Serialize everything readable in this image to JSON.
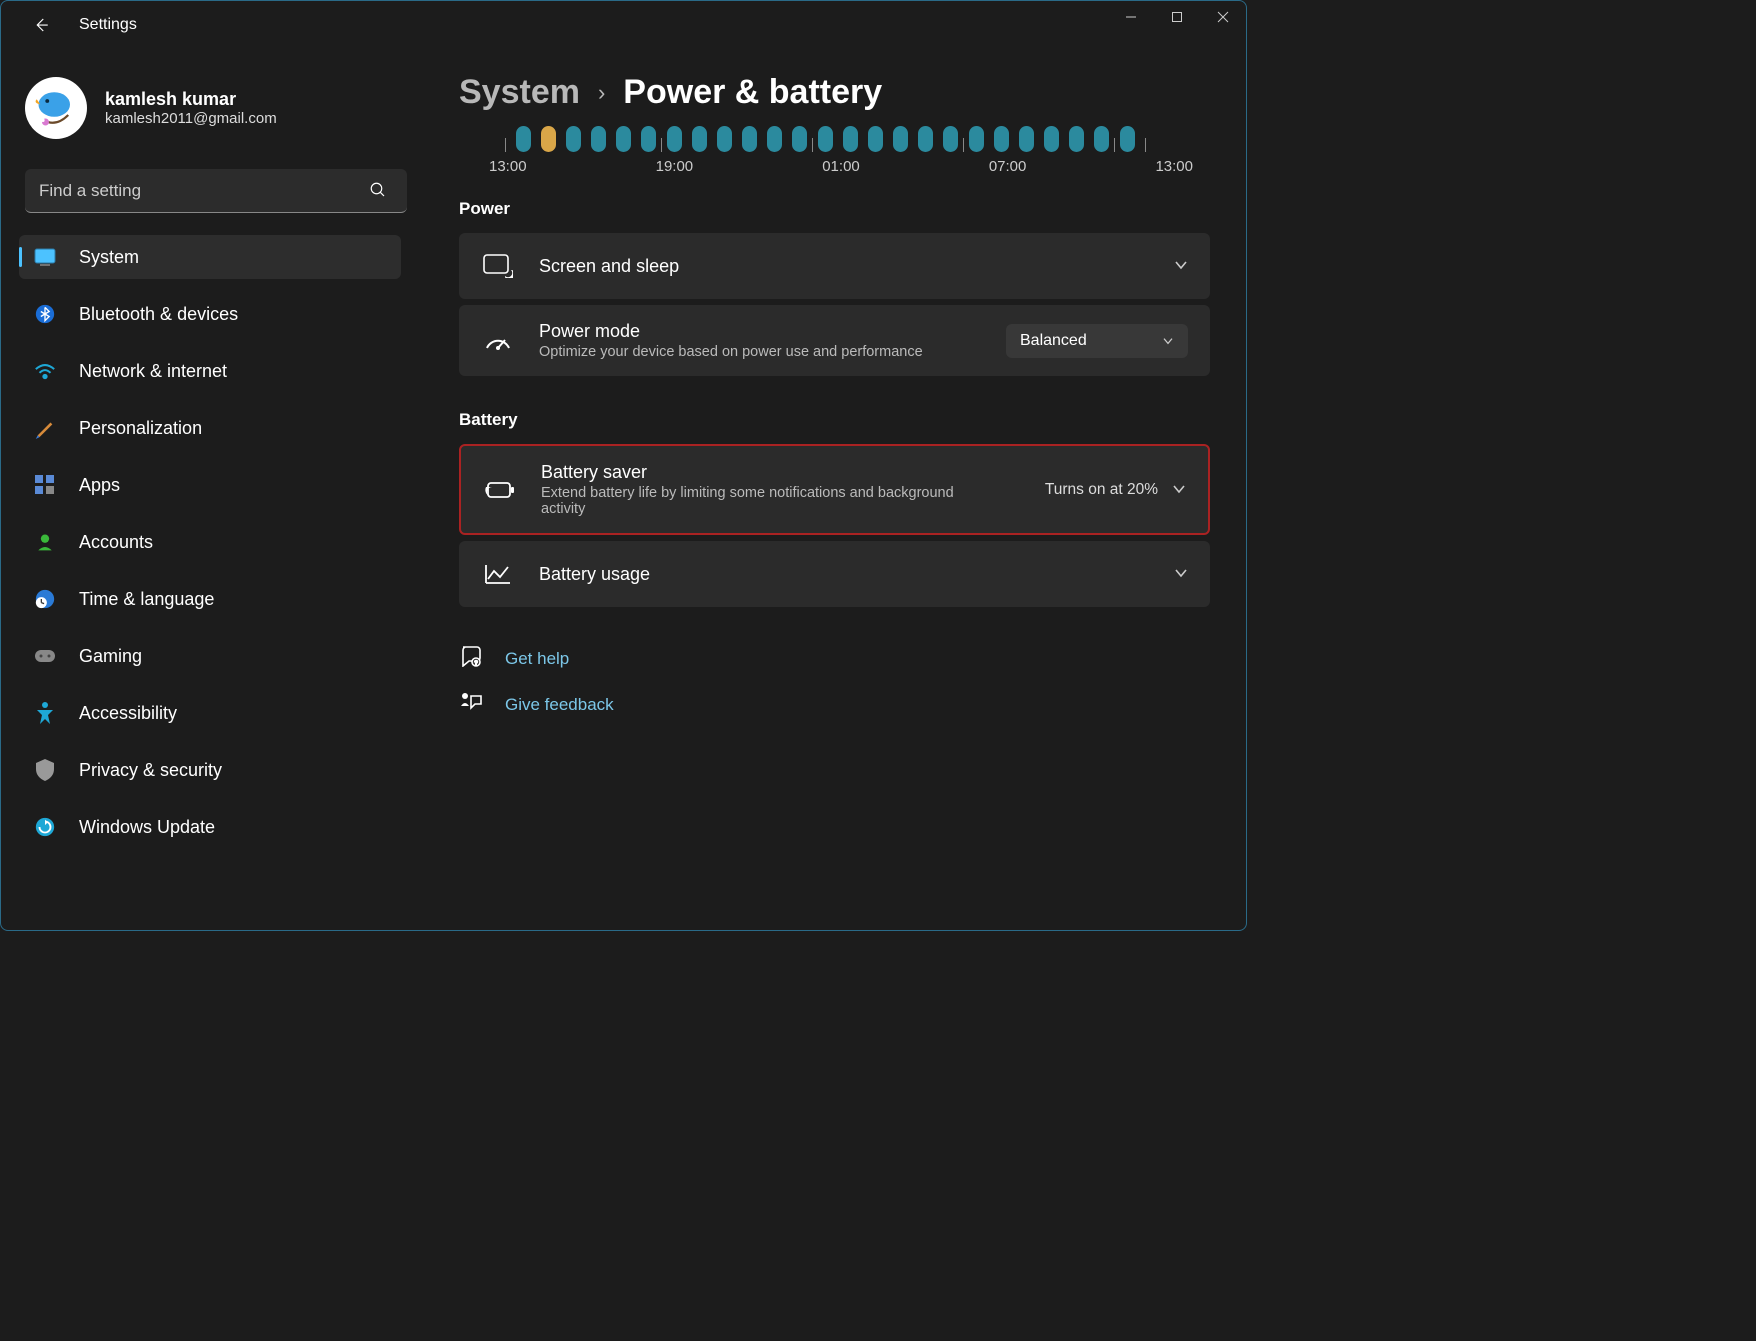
{
  "app_title": "Settings",
  "profile": {
    "name": "kamlesh kumar",
    "email": "kamlesh2011@gmail.com"
  },
  "search": {
    "placeholder": "Find a setting"
  },
  "nav": {
    "system": "System",
    "bluetooth": "Bluetooth & devices",
    "network": "Network & internet",
    "personalization": "Personalization",
    "apps": "Apps",
    "accounts": "Accounts",
    "time": "Time & language",
    "gaming": "Gaming",
    "accessibility": "Accessibility",
    "privacy": "Privacy & security",
    "update": "Windows Update"
  },
  "breadcrumb": {
    "parent": "System",
    "current": "Power & battery"
  },
  "chart_data": {
    "type": "bar",
    "categories": [
      "13:00",
      "14:00",
      "15:00",
      "16:00",
      "17:00",
      "18:00",
      "19:00",
      "20:00",
      "21:00",
      "22:00",
      "23:00",
      "00:00",
      "01:00",
      "02:00",
      "03:00",
      "04:00",
      "05:00",
      "06:00",
      "07:00",
      "08:00",
      "09:00",
      "10:00",
      "11:00",
      "12:00",
      "13:00"
    ],
    "values": [
      1,
      1,
      1,
      1,
      1,
      1,
      1,
      1,
      1,
      1,
      1,
      1,
      1,
      1,
      1,
      1,
      1,
      1,
      1,
      1,
      1,
      1,
      1,
      1,
      1
    ],
    "highlight_index": 1,
    "x_tick_labels": [
      "13:00",
      "19:00",
      "01:00",
      "07:00",
      "13:00"
    ],
    "title": "",
    "xlabel": "",
    "ylabel": ""
  },
  "sections": {
    "power": "Power",
    "battery": "Battery"
  },
  "cards": {
    "screen_sleep": {
      "title": "Screen and sleep"
    },
    "power_mode": {
      "title": "Power mode",
      "desc": "Optimize your device based on power use and performance",
      "value": "Balanced"
    },
    "battery_saver": {
      "title": "Battery saver",
      "desc": "Extend battery life by limiting some notifications and background activity",
      "value": "Turns on at 20%"
    },
    "battery_usage": {
      "title": "Battery usage"
    }
  },
  "links": {
    "help": "Get help",
    "feedback": "Give feedback"
  }
}
